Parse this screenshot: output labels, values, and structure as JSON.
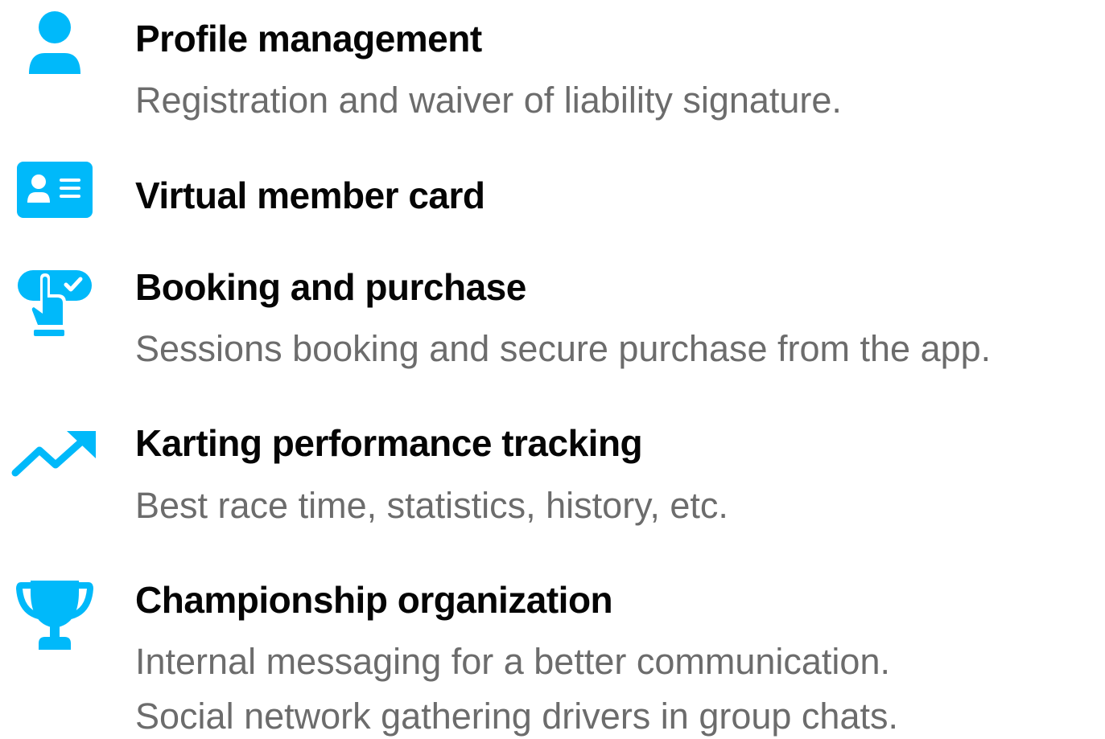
{
  "colors": {
    "accent": "#00B9FA",
    "title": "#050505",
    "description": "#6C6C6C"
  },
  "features": [
    {
      "icon": "user-icon",
      "title": "Profile management",
      "description": [
        "Registration and waiver of liability signature."
      ]
    },
    {
      "icon": "id-card-icon",
      "title": "Virtual member card",
      "description": []
    },
    {
      "icon": "tap-check-icon",
      "title": "Booking and purchase",
      "description": [
        "Sessions booking and secure purchase from the app."
      ]
    },
    {
      "icon": "trending-up-icon",
      "title": "Karting performance tracking",
      "description": [
        "Best race time, statistics, history, etc."
      ]
    },
    {
      "icon": "trophy-icon",
      "title": "Championship organization",
      "description": [
        "Internal messaging for a better communication.",
        "Social network gathering drivers in group chats."
      ]
    }
  ]
}
